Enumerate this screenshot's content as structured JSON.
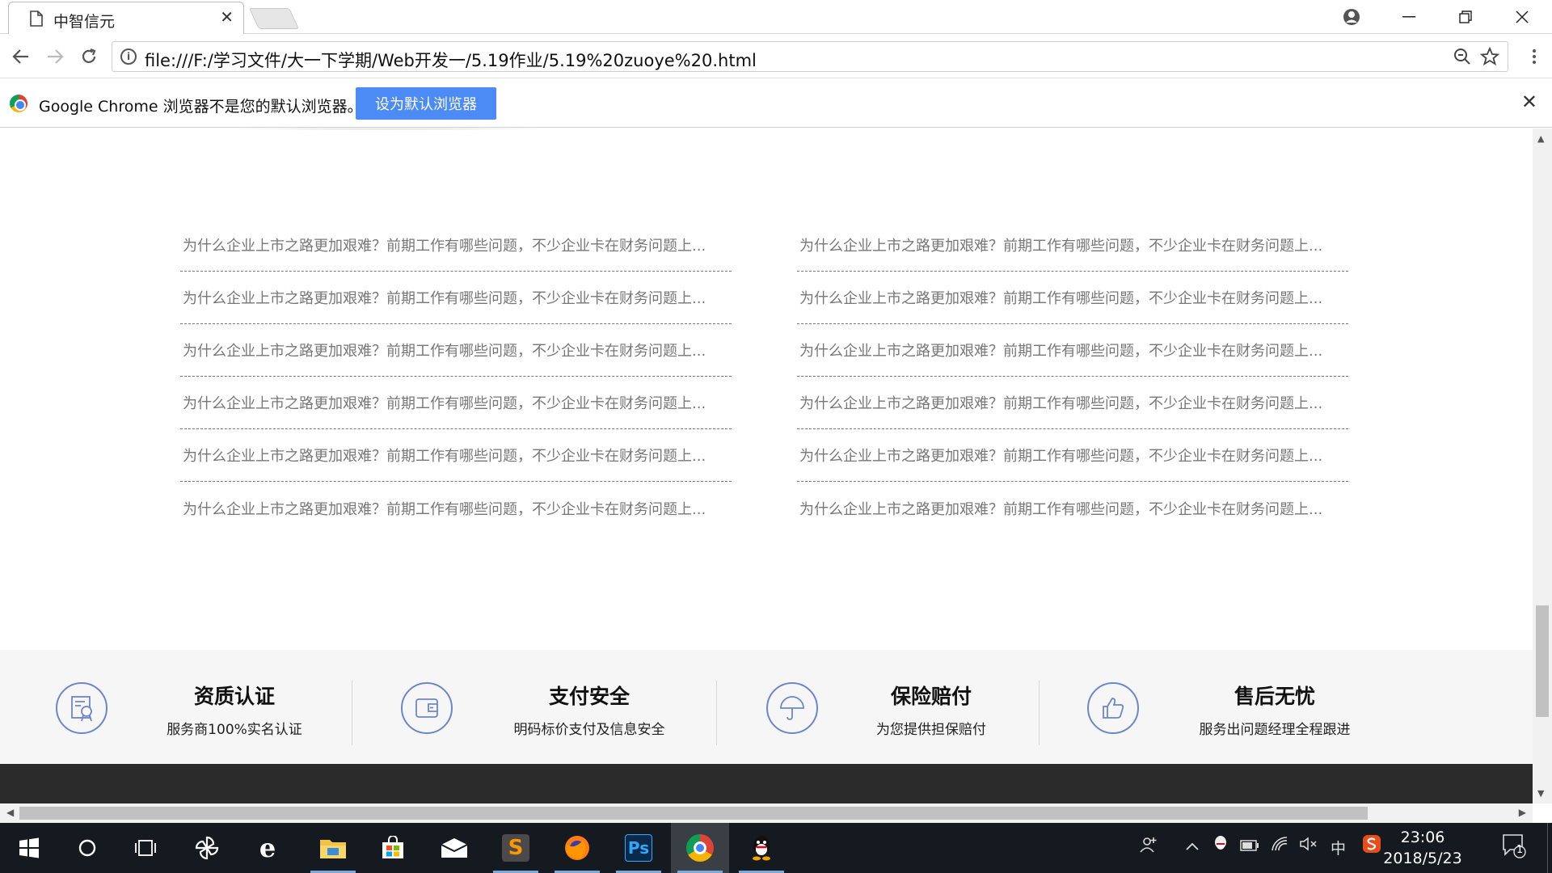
{
  "browser": {
    "tab_title": "中智信元",
    "url": "file:///F:/学习文件/大一下学期/Web开发一/5.19作业/5.19%20zuoye%20.html",
    "infobar_message": "Google Chrome 浏览器不是您的默认浏览器。",
    "infobar_button": "设为默认浏览器"
  },
  "news": {
    "left": [
      "为什么企业上市之路更加艰难？前期工作有哪些问题，不少企业卡在财务问题上...",
      "为什么企业上市之路更加艰难？前期工作有哪些问题，不少企业卡在财务问题上...",
      "为什么企业上市之路更加艰难？前期工作有哪些问题，不少企业卡在财务问题上...",
      "为什么企业上市之路更加艰难？前期工作有哪些问题，不少企业卡在财务问题上...",
      "为什么企业上市之路更加艰难？前期工作有哪些问题，不少企业卡在财务问题上...",
      "为什么企业上市之路更加艰难？前期工作有哪些问题，不少企业卡在财务问题上..."
    ],
    "right": [
      "为什么企业上市之路更加艰难？前期工作有哪些问题，不少企业卡在财务问题上...",
      "为什么企业上市之路更加艰难？前期工作有哪些问题，不少企业卡在财务问题上...",
      "为什么企业上市之路更加艰难？前期工作有哪些问题，不少企业卡在财务问题上...",
      "为什么企业上市之路更加艰难？前期工作有哪些问题，不少企业卡在财务问题上...",
      "为什么企业上市之路更加艰难？前期工作有哪些问题，不少企业卡在财务问题上...",
      "为什么企业上市之路更加艰难？前期工作有哪些问题，不少企业卡在财务问题上..."
    ]
  },
  "features": [
    {
      "title": "资质认证",
      "sub": "服务商100%实名认证",
      "icon": "certificate-icon"
    },
    {
      "title": "支付安全",
      "sub": "明码标价支付及信息安全",
      "icon": "wallet-icon"
    },
    {
      "title": "保险赔付",
      "sub": "为您提供担保赔付",
      "icon": "umbrella-icon"
    },
    {
      "title": "售后无忧",
      "sub": "服务出问题经理全程跟进",
      "icon": "thumbs-up-icon"
    }
  ],
  "taskbar": {
    "time": "23:06",
    "date": "2018/5/23",
    "ime": "中",
    "notification_count": "1",
    "ps_label": "Ps"
  },
  "colors": {
    "accent_blue": "#4c8bf5",
    "feature_icon": "#6d86c9",
    "footer_dark": "#2b2b2b",
    "taskbar": "#151a20"
  }
}
